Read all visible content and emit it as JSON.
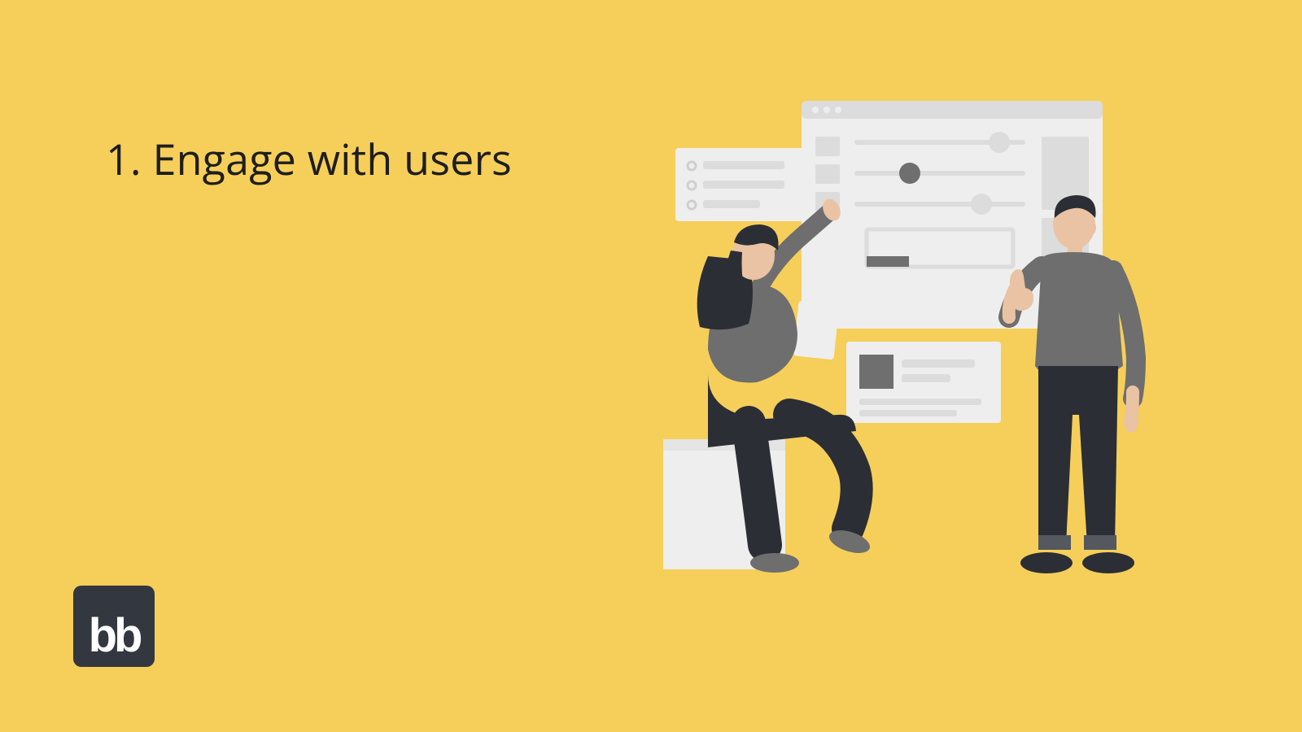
{
  "slide": {
    "heading": "1. Engage with users",
    "logo_text": "bb"
  },
  "colors": {
    "background": "#f6cf5a",
    "text": "#1e1e1e",
    "logo_bg": "#333740",
    "logo_fg": "#ffffff",
    "panel_light": "#eeeeee",
    "panel_mid": "#dcdcdc",
    "panel_dark": "#6f6f6f",
    "skin": "#e9c3a4",
    "dark": "#2b2e34",
    "grey": "#6e6e6e"
  }
}
